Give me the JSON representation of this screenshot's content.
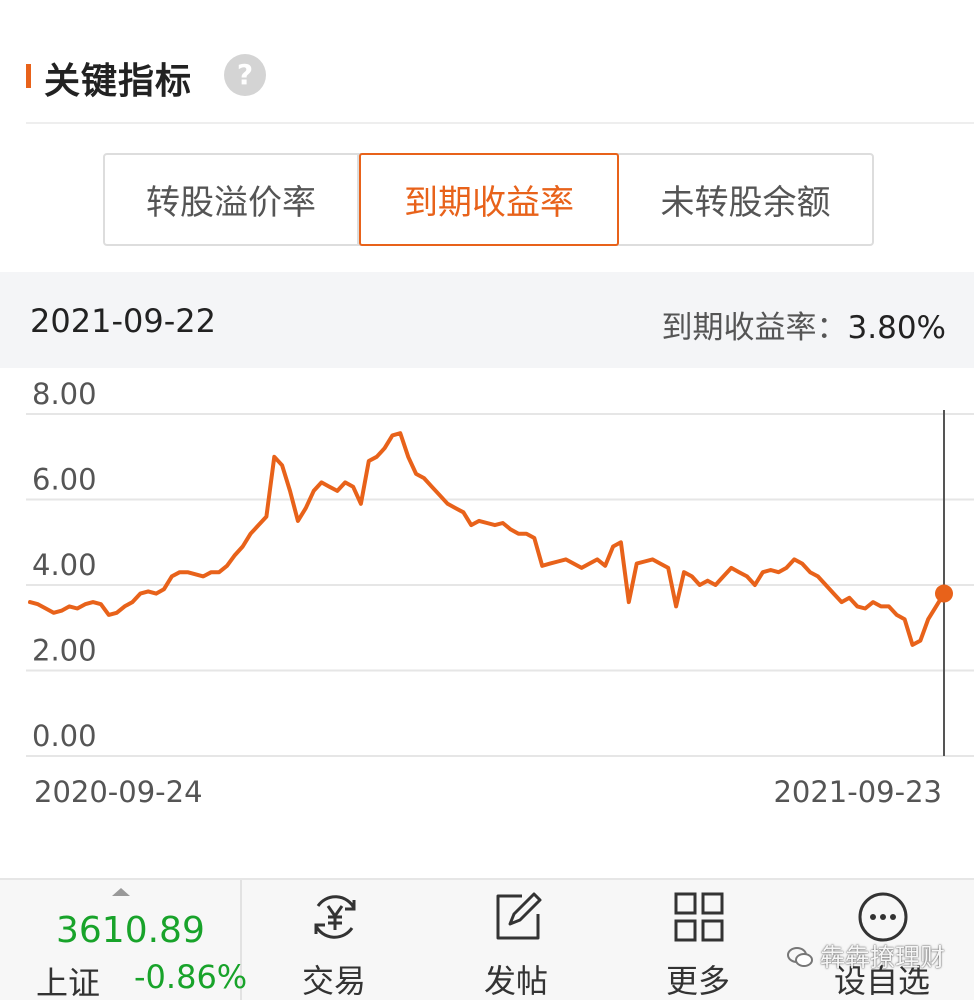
{
  "section": {
    "title": "关键指标",
    "help_icon": "question-circle-icon"
  },
  "tabs": [
    {
      "label": "转股溢价率",
      "active": false
    },
    {
      "label": "到期收益率",
      "active": true
    },
    {
      "label": "未转股余额",
      "active": false
    }
  ],
  "info": {
    "date": "2021-09-22",
    "metric_label": "到期收益率：",
    "metric_value": "3.80%"
  },
  "colors": {
    "accent": "#e8621a",
    "line": "#e8621a",
    "up_green": "#18a32a",
    "info_bg": "#f4f5f7"
  },
  "chart_data": {
    "type": "line",
    "title": "",
    "xlabel": "",
    "ylabel": "",
    "ylim": [
      0,
      8
    ],
    "y_ticks": [
      "8.00",
      "6.00",
      "4.00",
      "2.00",
      "0.00"
    ],
    "x_tick_labels": [
      "2020-09-24",
      "2021-09-23"
    ],
    "grid": true,
    "series": [
      {
        "values": [
          3.6,
          3.55,
          3.45,
          3.35,
          3.4,
          3.5,
          3.45,
          3.55,
          3.6,
          3.55,
          3.3,
          3.35,
          3.5,
          3.6,
          3.8,
          3.85,
          3.8,
          3.9,
          4.2,
          4.3,
          4.3,
          4.25,
          4.2,
          4.3,
          4.3,
          4.45,
          4.7,
          4.9,
          5.2,
          5.4,
          5.6,
          7.0,
          6.8,
          6.2,
          5.5,
          5.8,
          6.2,
          6.4,
          6.3,
          6.2,
          6.4,
          6.3,
          5.9,
          6.9,
          7.0,
          7.2,
          7.5,
          7.55,
          7.0,
          6.6,
          6.5,
          6.3,
          6.1,
          5.9,
          5.8,
          5.7,
          5.4,
          5.5,
          5.45,
          5.4,
          5.45,
          5.3,
          5.2,
          5.2,
          5.1,
          4.45,
          4.5,
          4.55,
          4.6,
          4.5,
          4.4,
          4.5,
          4.6,
          4.45,
          4.9,
          5.0,
          3.6,
          4.5,
          4.55,
          4.6,
          4.5,
          4.4,
          3.5,
          4.3,
          4.2,
          4.0,
          4.1,
          4.0,
          4.2,
          4.4,
          4.3,
          4.2,
          4.0,
          4.3,
          4.35,
          4.3,
          4.4,
          4.6,
          4.5,
          4.3,
          4.2,
          4.0,
          3.8,
          3.6,
          3.7,
          3.5,
          3.45,
          3.6,
          3.5,
          3.5,
          3.3,
          3.2,
          2.6,
          2.7,
          3.2,
          3.5,
          3.8
        ]
      }
    ],
    "highlight": {
      "date": "2021-09-22",
      "value": 3.8
    }
  },
  "bottom_nav": {
    "index": {
      "value": "3610.89",
      "name": "上证",
      "change": "-0.86%"
    },
    "items": [
      {
        "label": "交易",
        "icon": "yuan-exchange-icon"
      },
      {
        "label": "发帖",
        "icon": "edit-post-icon"
      },
      {
        "label": "更多",
        "icon": "grid-more-icon"
      },
      {
        "label": "设自选",
        "icon": "more-dots-circle-icon"
      }
    ]
  },
  "watermark": {
    "text": "犇犇撩理财",
    "icon": "wechat-icon"
  }
}
